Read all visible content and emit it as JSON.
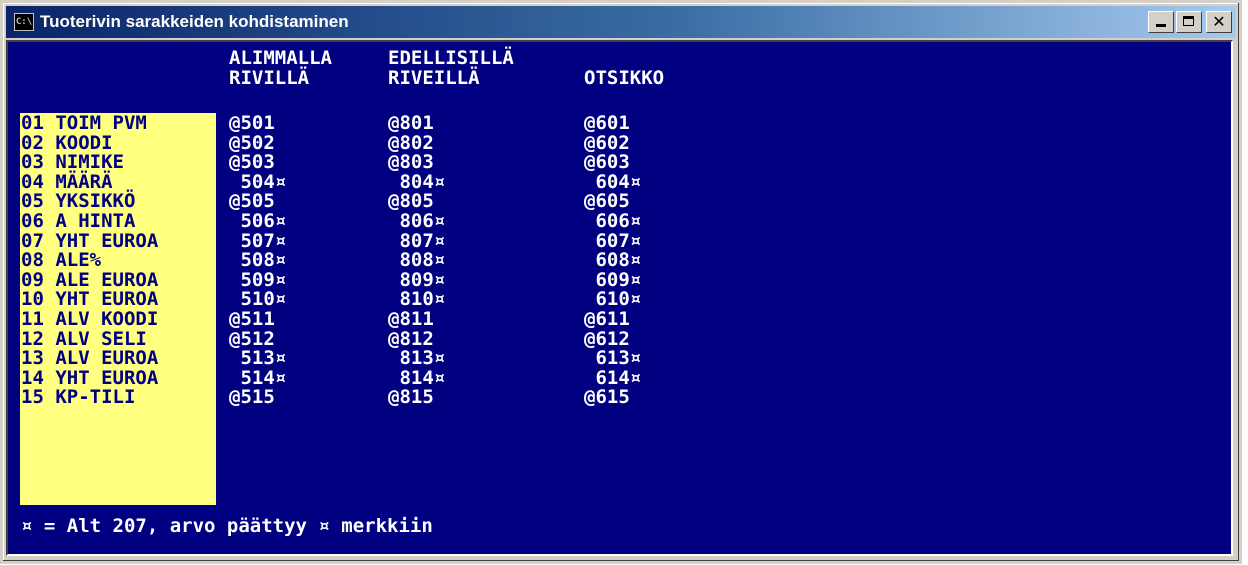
{
  "window": {
    "title": "Tuoterivin sarakkeiden kohdistaminen",
    "icon_text": "C:\\"
  },
  "headers": {
    "col1_line1": "ALIMMALLA",
    "col1_line2": "RIVILLÄ",
    "col2_line1": "EDELLISILLÄ",
    "col2_line2": "RIVEILLÄ",
    "col3_line2": "OTSIKKO"
  },
  "rows": [
    {
      "label": "01 TOIM PVM",
      "c1": "@501",
      "c2": "@801",
      "c3": "@601"
    },
    {
      "label": "02 KOODI",
      "c1": "@502",
      "c2": "@802",
      "c3": "@602"
    },
    {
      "label": "03 NIMIKE",
      "c1": "@503",
      "c2": "@803",
      "c3": "@603"
    },
    {
      "label": "04 MÄÄRÄ",
      "c1": " 504¤",
      "c2": " 804¤",
      "c3": " 604¤"
    },
    {
      "label": "05 YKSIKKÖ",
      "c1": "@505",
      "c2": "@805",
      "c3": "@605"
    },
    {
      "label": "06 A HINTA",
      "c1": " 506¤",
      "c2": " 806¤",
      "c3": " 606¤"
    },
    {
      "label": "07 YHT EUROA",
      "c1": " 507¤",
      "c2": " 807¤",
      "c3": " 607¤"
    },
    {
      "label": "08 ALE%",
      "c1": " 508¤",
      "c2": " 808¤",
      "c3": " 608¤"
    },
    {
      "label": "09 ALE EUROA",
      "c1": " 509¤",
      "c2": " 809¤",
      "c3": " 609¤"
    },
    {
      "label": "10 YHT EUROA",
      "c1": " 510¤",
      "c2": " 810¤",
      "c3": " 610¤"
    },
    {
      "label": "11 ALV KOODI",
      "c1": "@511",
      "c2": "@811",
      "c3": "@611"
    },
    {
      "label": "12 ALV SELI",
      "c1": "@512",
      "c2": "@812",
      "c3": "@612"
    },
    {
      "label": "13 ALV EUROA",
      "c1": " 513¤",
      "c2": " 813¤",
      "c3": " 613¤"
    },
    {
      "label": "14 YHT EUROA",
      "c1": " 514¤",
      "c2": " 814¤",
      "c3": " 614¤"
    },
    {
      "label": "15 KP-TILI",
      "c1": "@515",
      "c2": "@815",
      "c3": "@615"
    }
  ],
  "footer": "¤ = Alt 207, arvo päättyy ¤ merkkiin",
  "colors": {
    "console_bg": "#000080",
    "console_text": "#ffffff",
    "label_bg": "#ffff80",
    "label_text": "#000080"
  }
}
